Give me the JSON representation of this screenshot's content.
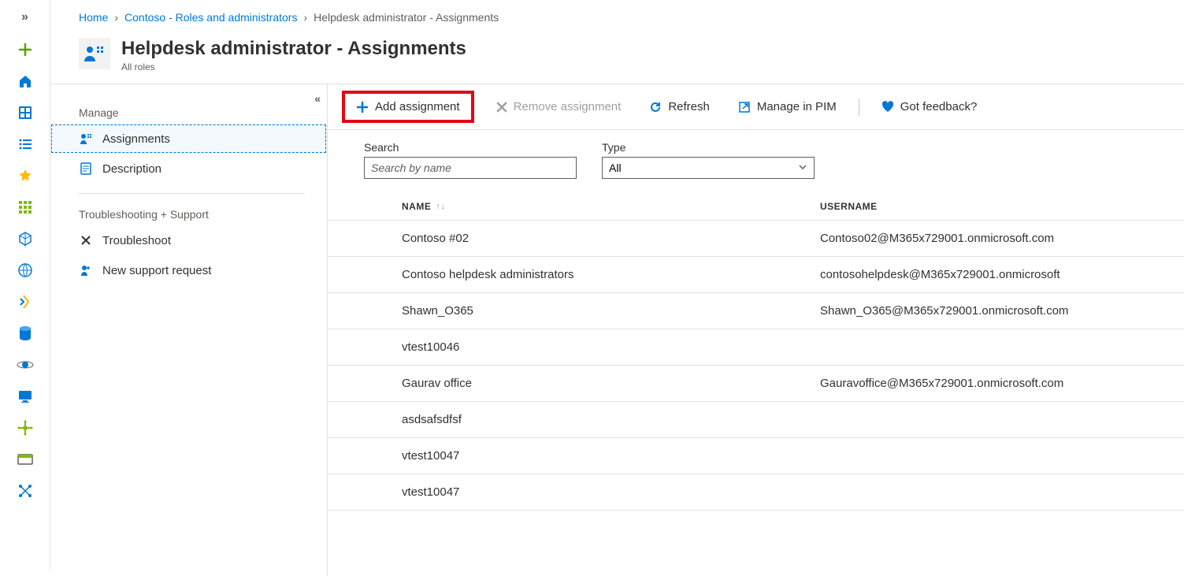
{
  "breadcrumb": {
    "home": "Home",
    "roles": "Contoso - Roles and administrators",
    "current": "Helpdesk administrator - Assignments"
  },
  "header": {
    "title": "Helpdesk administrator - Assignments",
    "subtitle": "All roles"
  },
  "sidebar": {
    "manage_label": "Manage",
    "assignments": "Assignments",
    "description": "Description",
    "troubleshoot_section": "Troubleshooting + Support",
    "troubleshoot": "Troubleshoot",
    "new_support": "New support request"
  },
  "commands": {
    "add": "Add assignment",
    "remove": "Remove assignment",
    "refresh": "Refresh",
    "manage_pim": "Manage in PIM",
    "feedback": "Got feedback?"
  },
  "filters": {
    "search_label": "Search",
    "search_placeholder": "Search by name",
    "type_label": "Type",
    "type_value": "All"
  },
  "table": {
    "col_name": "NAME",
    "col_user": "USERNAME",
    "rows": [
      {
        "name": "Contoso #02",
        "user": "Contoso02@M365x729001.onmicrosoft.com"
      },
      {
        "name": "Contoso helpdesk administrators",
        "user": "contosohelpdesk@M365x729001.onmicrosoft"
      },
      {
        "name": "Shawn_O365",
        "user": "Shawn_O365@M365x729001.onmicrosoft.com"
      },
      {
        "name": "vtest10046",
        "user": ""
      },
      {
        "name": "Gaurav office",
        "user": "Gauravoffice@M365x729001.onmicrosoft.com"
      },
      {
        "name": "asdsafsdfsf",
        "user": ""
      },
      {
        "name": "vtest10047",
        "user": ""
      },
      {
        "name": "vtest10047",
        "user": ""
      }
    ]
  }
}
